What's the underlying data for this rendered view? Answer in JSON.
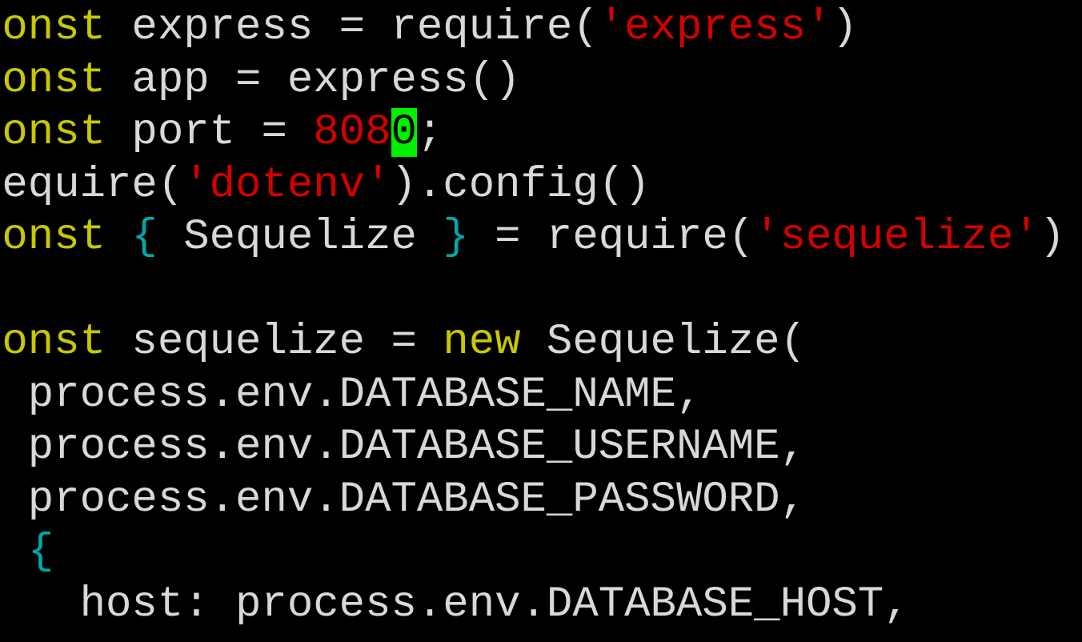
{
  "editor": {
    "colors": {
      "background": "#000000",
      "text": "#d8d8d8",
      "keyword": "#c8c800",
      "string": "#d40000",
      "number": "#d40000",
      "brace": "#00a8a8",
      "cursor": "#00f000"
    },
    "lines": [
      [
        {
          "t": "const",
          "c": "kw"
        },
        {
          "t": " express = require(",
          "c": ""
        },
        {
          "t": "'express'",
          "c": "str"
        },
        {
          "t": ")",
          "c": ""
        }
      ],
      [
        {
          "t": "const",
          "c": "kw"
        },
        {
          "t": " app = express()",
          "c": ""
        }
      ],
      [
        {
          "t": "const",
          "c": "kw"
        },
        {
          "t": " port = ",
          "c": ""
        },
        {
          "t": "808",
          "c": "num"
        },
        {
          "t": "0",
          "c": "cursor"
        },
        {
          "t": ";",
          "c": ""
        }
      ],
      [
        {
          "t": "require(",
          "c": ""
        },
        {
          "t": "'dotenv'",
          "c": "str"
        },
        {
          "t": ").config()",
          "c": ""
        }
      ],
      [
        {
          "t": "const",
          "c": "kw"
        },
        {
          "t": " ",
          "c": ""
        },
        {
          "t": "{",
          "c": "brace"
        },
        {
          "t": " Sequelize ",
          "c": ""
        },
        {
          "t": "}",
          "c": "brace"
        },
        {
          "t": " = require(",
          "c": ""
        },
        {
          "t": "'sequelize'",
          "c": "str"
        },
        {
          "t": ")",
          "c": ""
        }
      ],
      [],
      [
        {
          "t": "const",
          "c": "kw"
        },
        {
          "t": " sequelize = ",
          "c": ""
        },
        {
          "t": "new",
          "c": "kw"
        },
        {
          "t": " Sequelize(",
          "c": ""
        }
      ],
      [
        {
          "t": "  process.env.DATABASE_NAME,",
          "c": ""
        }
      ],
      [
        {
          "t": "  process.env.DATABASE_USERNAME,",
          "c": ""
        }
      ],
      [
        {
          "t": "  process.env.DATABASE_PASSWORD,",
          "c": ""
        }
      ],
      [
        {
          "t": "  ",
          "c": ""
        },
        {
          "t": "{",
          "c": "brace"
        }
      ],
      [
        {
          "t": "    host: process.env.DATABASE_HOST,",
          "c": ""
        }
      ]
    ]
  }
}
